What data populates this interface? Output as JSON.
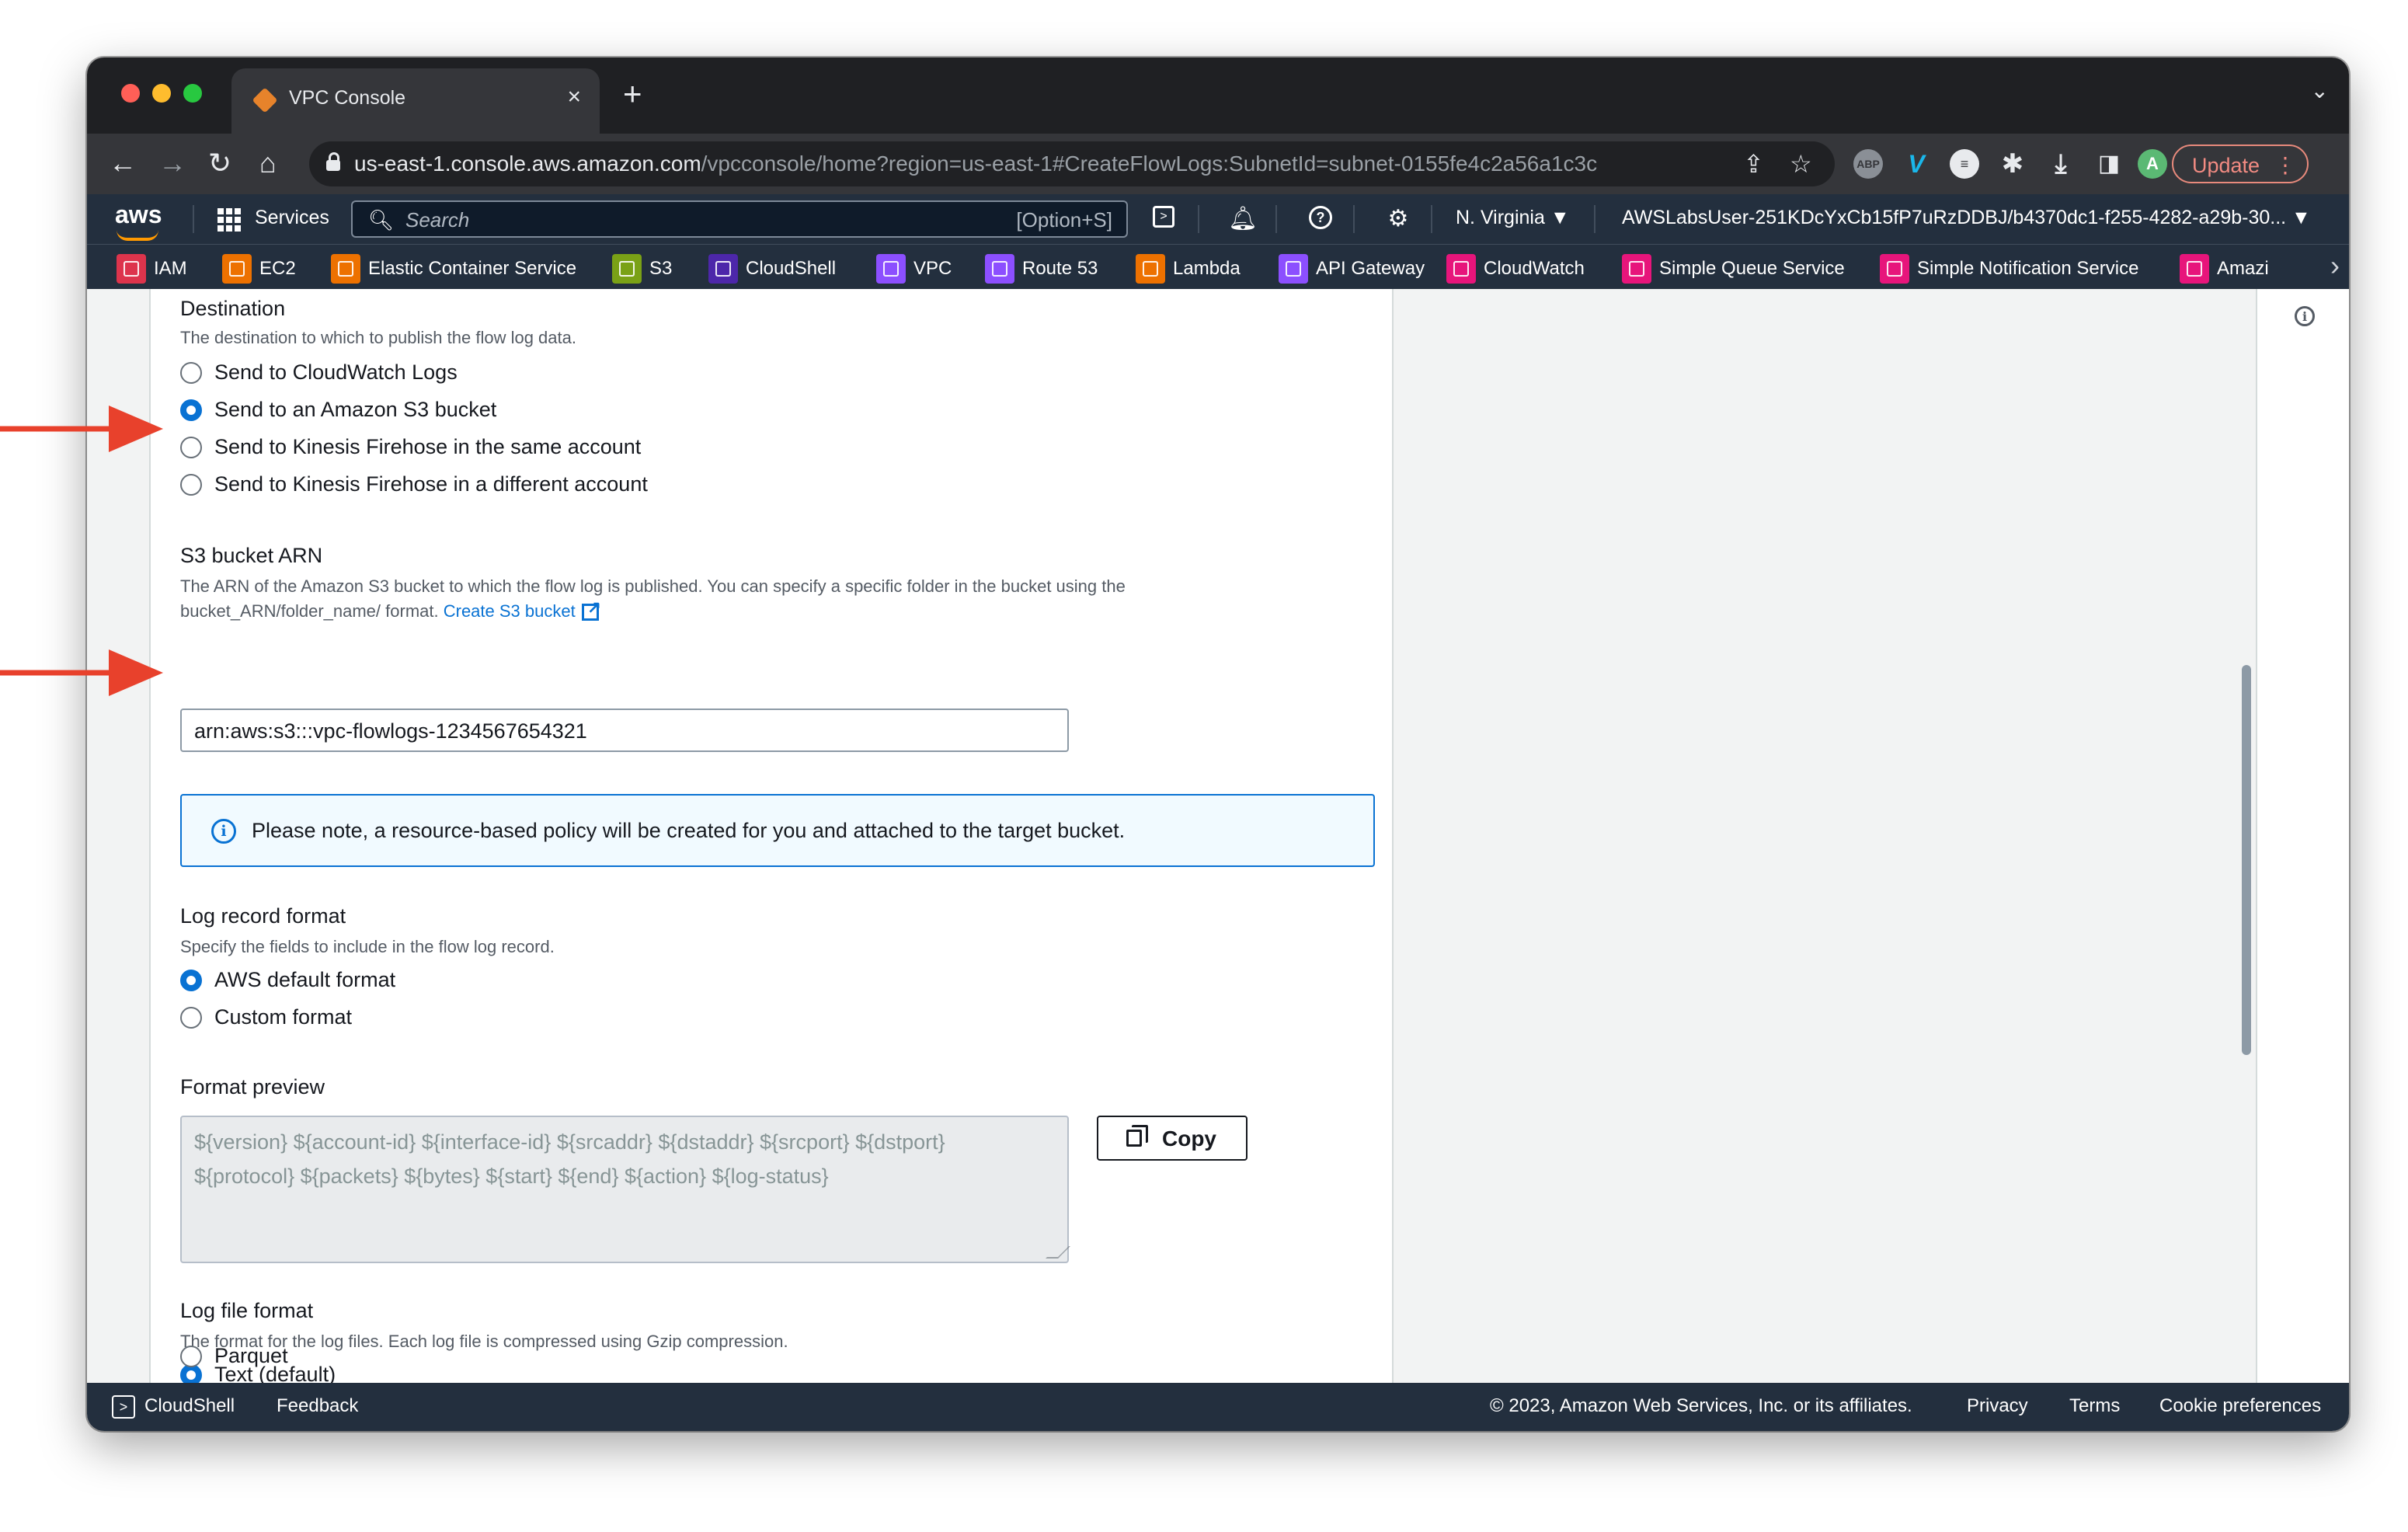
{
  "browser": {
    "tab_title": "VPC Console",
    "tab_close": "×",
    "new_tab": "+",
    "url_host": "us-east-1.console.aws.amazon.com",
    "url_path": "/vpcconsole/home?region=us-east-1#CreateFlowLogs:SubnetId=subnet-0155fe4c2a56a1c3c",
    "profile_initial": "A",
    "update_label": "Update",
    "ext_abp": "ABP",
    "ext_vimeo": "V"
  },
  "aws_nav": {
    "logo": "aws",
    "services_label": "Services",
    "search_placeholder": "Search",
    "search_shortcut": "[Option+S]",
    "region": "N. Virginia ▼",
    "account": "AWSLabsUser-251KDcYxCb15fP7uRzDDBJ/b4370dc1-f255-4282-a29b-30... ▼"
  },
  "favorites": [
    {
      "label": "IAM",
      "color": "#dd344c"
    },
    {
      "label": "EC2",
      "color": "#ed7100"
    },
    {
      "label": "Elastic Container Service",
      "color": "#ed7100"
    },
    {
      "label": "S3",
      "color": "#7aa116"
    },
    {
      "label": "CloudShell",
      "color": "#4d27aa"
    },
    {
      "label": "VPC",
      "color": "#8c4fff"
    },
    {
      "label": "Route 53",
      "color": "#8c4fff"
    },
    {
      "label": "Lambda",
      "color": "#ed7100"
    },
    {
      "label": "API Gateway",
      "color": "#8c4fff"
    },
    {
      "label": "CloudWatch",
      "color": "#e7157b"
    },
    {
      "label": "Simple Queue Service",
      "color": "#e7157b"
    },
    {
      "label": "Simple Notification Service",
      "color": "#e7157b"
    },
    {
      "label": "Amazi",
      "color": "#e7157b"
    }
  ],
  "form": {
    "destination": {
      "label": "Destination",
      "description": "The destination to which to publish the flow log data.",
      "options": [
        {
          "label": "Send to CloudWatch Logs",
          "selected": false
        },
        {
          "label": "Send to an Amazon S3 bucket",
          "selected": true
        },
        {
          "label": "Send to Kinesis Firehose in the same account",
          "selected": false
        },
        {
          "label": "Send to Kinesis Firehose in a different account",
          "selected": false
        }
      ]
    },
    "s3_bucket_arn": {
      "label": "S3 bucket ARN",
      "description_line1": "The ARN of the Amazon S3 bucket to which the flow log is published. You can specify a specific folder in the bucket using the",
      "description_line2": "bucket_ARN/folder_name/ format.",
      "create_link": "Create S3 bucket",
      "value": "arn:aws:s3:::vpc-flowlogs-1234567654321"
    },
    "notice": "Please note, a resource-based policy will be created for you and attached to the target bucket.",
    "log_record_format": {
      "label": "Log record format",
      "description": "Specify the fields to include in the flow log record.",
      "options": [
        {
          "label": "AWS default format",
          "selected": true
        },
        {
          "label": "Custom format",
          "selected": false
        }
      ]
    },
    "format_preview": {
      "label": "Format preview",
      "line1": "${version} ${account-id} ${interface-id} ${srcaddr} ${dstaddr} ${srcport} ${dstport}",
      "line2": "${protocol} ${packets} ${bytes} ${start} ${end} ${action} ${log-status}",
      "copy_label": "Copy"
    },
    "log_file_format": {
      "label": "Log file format",
      "description": "The format for the log files. Each log file is compressed using Gzip compression.",
      "options": [
        {
          "label": "Text (default)",
          "selected": true
        },
        {
          "label": "Parquet",
          "selected": false
        }
      ]
    }
  },
  "footer": {
    "cloudshell": "CloudShell",
    "feedback": "Feedback",
    "copyright": "© 2023, Amazon Web Services, Inc. or its affiliates.",
    "privacy": "Privacy",
    "terms": "Terms",
    "cookie": "Cookie preferences"
  },
  "annotation_color": "#e8412c"
}
